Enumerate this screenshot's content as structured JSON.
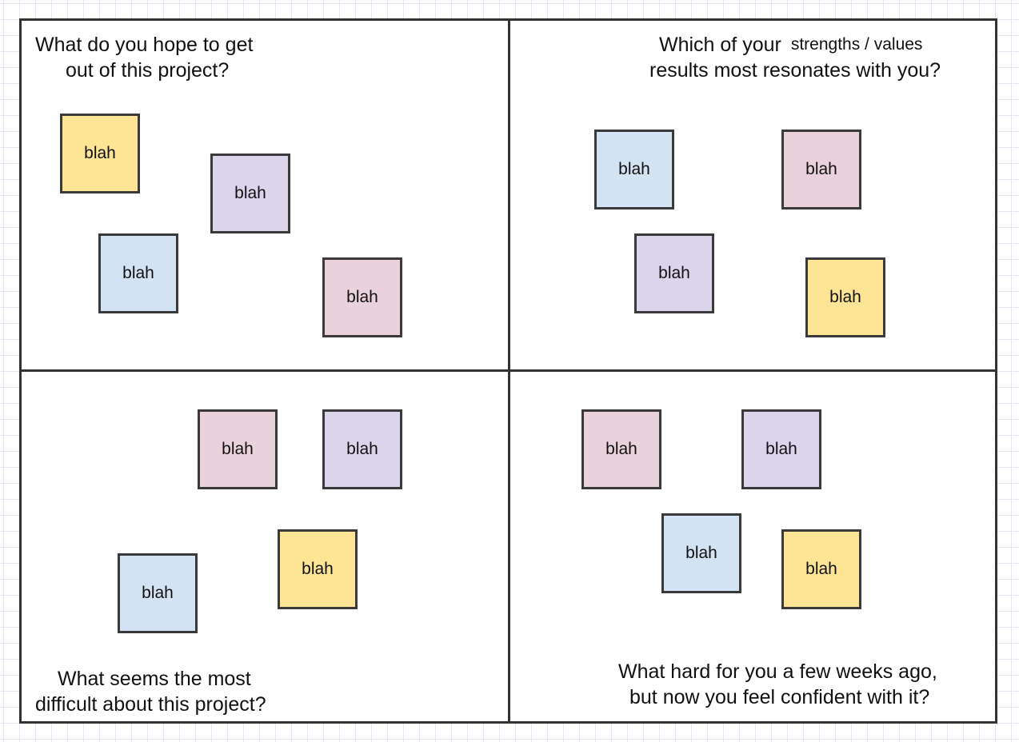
{
  "quadrants": {
    "top_left": {
      "prompt": [
        "What do you hope to get",
        "out of this project?"
      ],
      "notes": [
        {
          "text": "blah",
          "color": "#fde595"
        },
        {
          "text": "blah",
          "color": "#dcd4ea"
        },
        {
          "text": "blah",
          "color": "#d4e3f3"
        },
        {
          "text": "blah",
          "color": "#ead2dc"
        }
      ]
    },
    "top_right": {
      "prompt": [
        "Which of your",
        "strengths / values",
        "results most resonates with you?"
      ],
      "notes": [
        {
          "text": "blah",
          "color": "#d4e3f3"
        },
        {
          "text": "blah",
          "color": "#ead2dc"
        },
        {
          "text": "blah",
          "color": "#dcd4ea"
        },
        {
          "text": "blah",
          "color": "#fde595"
        }
      ]
    },
    "bottom_left": {
      "prompt": [
        "What seems the most",
        "difficult about this project?"
      ],
      "notes": [
        {
          "text": "blah",
          "color": "#ead2dc"
        },
        {
          "text": "blah",
          "color": "#dcd4ea"
        },
        {
          "text": "blah",
          "color": "#fde595"
        },
        {
          "text": "blah",
          "color": "#d4e3f3"
        }
      ]
    },
    "bottom_right": {
      "prompt": [
        "What hard for you a few weeks ago,",
        "but now you feel confident with it?"
      ],
      "notes": [
        {
          "text": "blah",
          "color": "#ead2dc"
        },
        {
          "text": "blah",
          "color": "#dcd4ea"
        },
        {
          "text": "blah",
          "color": "#d4e3f3"
        },
        {
          "text": "blah",
          "color": "#fde595"
        }
      ]
    }
  }
}
